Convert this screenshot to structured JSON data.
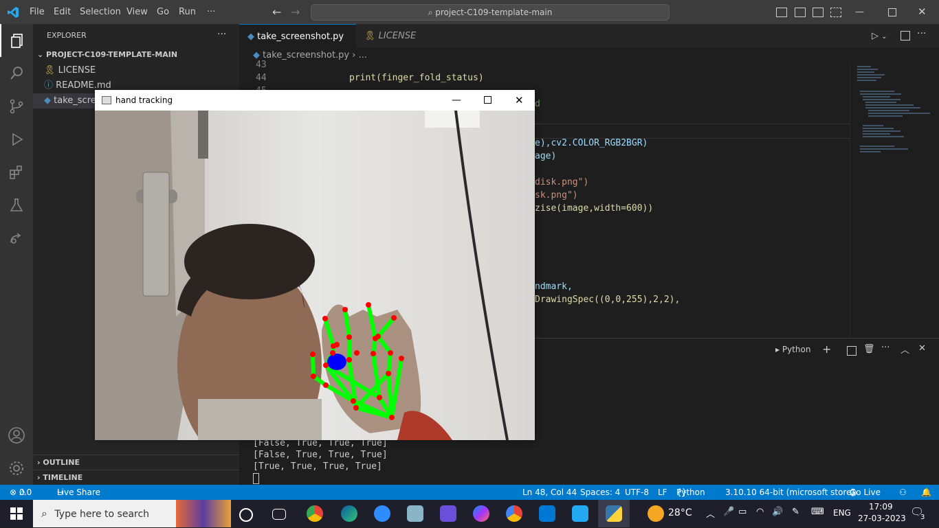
{
  "titlebar": {
    "menu": [
      "File",
      "Edit",
      "Selection",
      "View",
      "Go",
      "Run",
      "···"
    ],
    "search": "project-C109-template-main"
  },
  "explorer": {
    "header": "EXPLORER",
    "project": "PROJECT-C109-TEMPLATE-MAIN",
    "files": [
      "LICENSE",
      "README.md",
      "take_scree"
    ],
    "outline": "OUTLINE",
    "timeline": "TIMELINE"
  },
  "tabs": [
    {
      "label": "take_screenshot.py",
      "active": true
    },
    {
      "label": "LICENSE",
      "active": false
    }
  ],
  "breadcrumbs": {
    "file": "take_screenshot.py",
    "rest": "..."
  },
  "editor": {
    "line_numbers": [
      "43",
      "44",
      "45"
    ],
    "lines": [
      {
        "text": "print(finger_fold_status)"
      },
      {
        "text": "d"
      },
      {
        "text": "e),cv2.COLOR_RGB2BGR)"
      },
      {
        "text": "age)"
      },
      {
        "text": "disk.png\")"
      },
      {
        "text": "sk.png\")"
      },
      {
        "text": "zise(image,width=600))"
      },
      {
        "text": "ndmark,"
      },
      {
        "text": "DrawingSpec((0,0,255),2,2),"
      }
    ]
  },
  "panel": {
    "terminal_name": "Python",
    "output": [
      "[False, True, True, True]",
      "[False, True, True, True]",
      "[True, True, True, True]"
    ]
  },
  "statusbar": {
    "errors": "0",
    "warnings": "0",
    "live_share": "Live Share",
    "position": "Ln 48, Col 44",
    "spaces": "Spaces: 4",
    "encoding": "UTF-8",
    "eol": "LF",
    "language": "Python",
    "interpreter": "3.10.10 64-bit (microsoft store)",
    "go_live": "Go Live"
  },
  "handwindow": {
    "title": "hand tracking"
  },
  "taskbar": {
    "search_placeholder": "Type here to search",
    "weather": "28°C",
    "lang": "ENG",
    "time": "17:09",
    "date": "27-03-2023",
    "notifications": "3"
  },
  "colors": {
    "accent": "#007acc",
    "keyword_yellow": "#dcdcaa",
    "identifier_blue": "#9cdcfe",
    "string_orange": "#ce9178",
    "number_green": "#b5cea8",
    "hand_green": "#00ff00",
    "landmark_red": "#ff0000"
  }
}
